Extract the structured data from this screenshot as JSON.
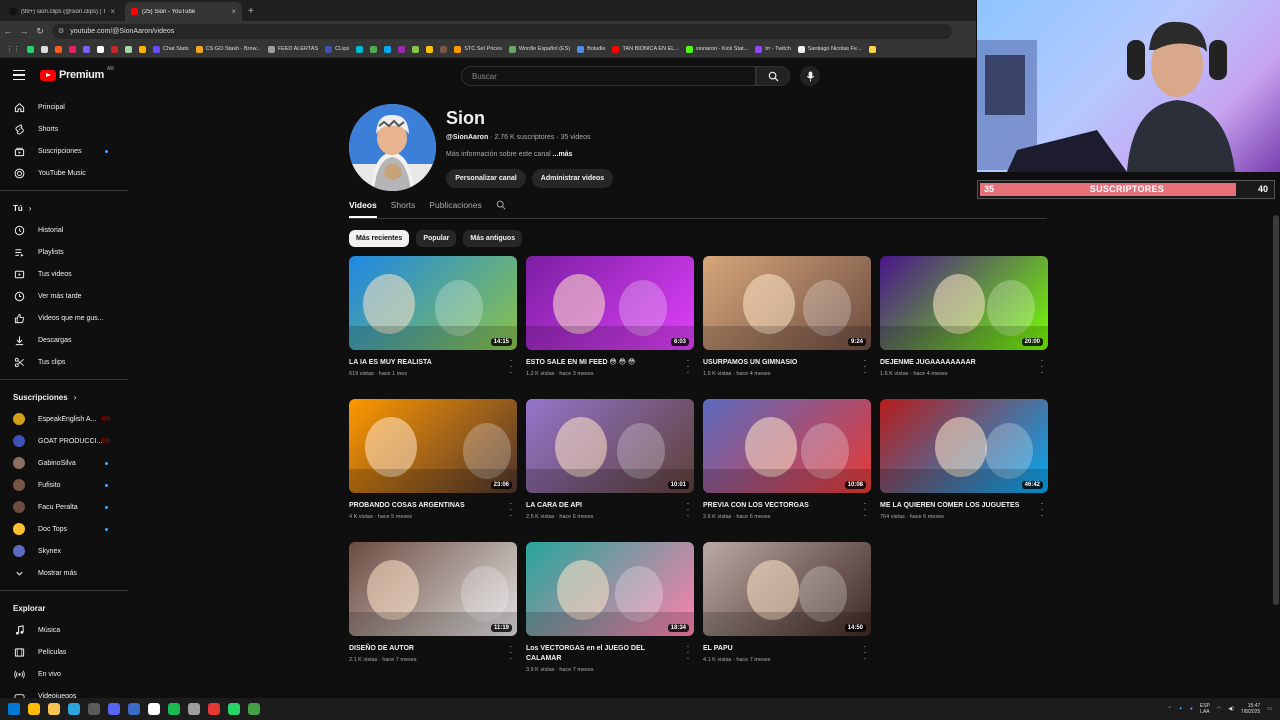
{
  "browser": {
    "tabs": [
      {
        "title": "(99+) sion.clips (@sion.clips) | TikTok",
        "active": false,
        "color": "#111111"
      },
      {
        "title": "(25) Sion - YouTube",
        "active": true,
        "color": "#ff0000"
      }
    ],
    "new_tab": "+",
    "url": "youtube.com/@SionAaron/videos",
    "bookmarks": [
      {
        "label": "",
        "color": "#25d366"
      },
      {
        "label": "",
        "color": "#dddddd"
      },
      {
        "label": "",
        "color": "#ff5a1f"
      },
      {
        "label": "",
        "color": "#e91e63"
      },
      {
        "label": "",
        "color": "#7b61ff"
      },
      {
        "label": "",
        "color": "#ffffff"
      },
      {
        "label": "",
        "color": "#c62828"
      },
      {
        "label": "",
        "color": "#a5d6a7"
      },
      {
        "label": "",
        "color": "#ffb300"
      },
      {
        "label": "Chat Stats",
        "color": "#6a4cff"
      },
      {
        "label": "CS:GO Stash - Brow...",
        "color": "#f5a623"
      },
      {
        "label": "FEED ALERTAS",
        "color": "#9e9e9e"
      },
      {
        "label": "CLips",
        "color": "#3f51b5"
      },
      {
        "label": "",
        "color": "#00bcd4"
      },
      {
        "label": "",
        "color": "#4caf50"
      },
      {
        "label": "",
        "color": "#03a9f4"
      },
      {
        "label": "",
        "color": "#9c27b0"
      },
      {
        "label": "",
        "color": "#8bc34a"
      },
      {
        "label": "",
        "color": "#ffc107"
      },
      {
        "label": "",
        "color": "#795548"
      },
      {
        "label": "STC Set Prices",
        "color": "#ff9800"
      },
      {
        "label": "Wordle Español (ES)",
        "color": "#6aaa64"
      },
      {
        "label": "Boludle",
        "color": "#4a90e2"
      },
      {
        "label": "TAN BIONICA EN EL...",
        "color": "#ff0000"
      },
      {
        "label": "sionaron - Kick Stat...",
        "color": "#53fc18"
      },
      {
        "label": "trr - Twitch",
        "color": "#9146ff"
      },
      {
        "label": "Santiago Nicolas Fe...",
        "color": "#eeeeee"
      },
      {
        "label": "",
        "color": "#ffd54f"
      }
    ]
  },
  "header": {
    "logo_text": "Premium",
    "logo_country": "AR",
    "search_placeholder": "Buscar"
  },
  "sidebar": {
    "main": [
      {
        "label": "Principal",
        "icon": "home-icon"
      },
      {
        "label": "Shorts",
        "icon": "shorts-icon"
      },
      {
        "label": "Suscripciones",
        "icon": "subscriptions-icon",
        "dot": true
      },
      {
        "label": "YouTube Music",
        "icon": "music-circle-icon"
      }
    ],
    "you_heading": "Tú",
    "you": [
      {
        "label": "Historial",
        "icon": "history-icon"
      },
      {
        "label": "Playlists",
        "icon": "playlists-icon"
      },
      {
        "label": "Tus videos",
        "icon": "your-videos-icon"
      },
      {
        "label": "Ver más tarde",
        "icon": "watch-later-icon"
      },
      {
        "label": "Videos que me gus...",
        "icon": "like-icon"
      },
      {
        "label": "Descargas",
        "icon": "download-icon"
      },
      {
        "label": "Tus clips",
        "icon": "clips-icon"
      }
    ],
    "subs_heading": "Suscripciones",
    "subs": [
      {
        "label": "EspeakEnglish A...",
        "color": "#d4a017",
        "live": true
      },
      {
        "label": "GOAT PRODUCCI...",
        "color": "#3f51b5",
        "live": true
      },
      {
        "label": "GabinoSilva",
        "color": "#8d6e63",
        "dot": true
      },
      {
        "label": "Fufisito",
        "color": "#795548",
        "dot": true
      },
      {
        "label": "Facu Peralta",
        "color": "#6d4c41",
        "dot": true
      },
      {
        "label": "Doc Tops",
        "color": "#fbc02d",
        "dot": true
      },
      {
        "label": "Skynex",
        "color": "#5c6bc0",
        "dot": false
      }
    ],
    "show_more": "Mostrar más",
    "explore_heading": "Explorar",
    "explore": [
      {
        "label": "Música",
        "icon": "music-note-icon"
      },
      {
        "label": "Películas",
        "icon": "movies-icon"
      },
      {
        "label": "En vivo",
        "icon": "live-icon"
      },
      {
        "label": "Videojuegos",
        "icon": "gaming-icon"
      }
    ]
  },
  "channel": {
    "name": "Sion",
    "handle": "@SionAaron",
    "meta": " · 2.76 K suscriptores · 35 videos",
    "more_text": "Más información sobre este canal ",
    "more_link": "...más",
    "customize_btn": "Personalizar canal",
    "manage_btn": "Administrar videos",
    "tabs": [
      "Videos",
      "Shorts",
      "Publicaciones"
    ],
    "chips": [
      "Más recientes",
      "Popular",
      "Más antiguos"
    ]
  },
  "videos": [
    {
      "title": "LA IA ES MUY REALISTA",
      "meta": "619 vistas · hace 1 mes",
      "duration": "14:15",
      "c1": "#1e88e5",
      "c2": "#8bc34a"
    },
    {
      "title": "ESTO SALE EN MI FEED 😳 😳 😳",
      "meta": "1.2 K vistas · hace 3 meses",
      "duration": "6:03",
      "c1": "#7b1fa2",
      "c2": "#e040fb"
    },
    {
      "title": "USURPAMOS UN GIMNASIO",
      "meta": "1.5 K vistas · hace 4 meses",
      "duration": "9:24",
      "c1": "#d7a77a",
      "c2": "#6d4c41"
    },
    {
      "title": "DEJENME JUGAAAAAAAAR",
      "meta": "1.6 K vistas · hace 4 meses",
      "duration": "20:00",
      "c1": "#4a148c",
      "c2": "#76ff03"
    },
    {
      "title": "PROBANDO COSAS ARGENTINAS",
      "meta": "4 K vistas · hace 5 meses",
      "duration": "23:06",
      "c1": "#ff9800",
      "c2": "#4e342e"
    },
    {
      "title": "LA CARA DE API",
      "meta": "2.5 K vistas · hace 6 meses",
      "duration": "10:01",
      "c1": "#9575cd",
      "c2": "#5d4037"
    },
    {
      "title": "PREVIA CON LOS VECTORGAS",
      "meta": "2.6 K vistas · hace 6 meses",
      "duration": "10:08",
      "c1": "#5c6bc0",
      "c2": "#e53935"
    },
    {
      "title": "ME LA QUIEREN COMER LOS JUGUETES",
      "meta": "764 vistas · hace 6 meses",
      "duration": "46:42",
      "c1": "#b71c1c",
      "c2": "#03a9f4"
    },
    {
      "title": "DISEÑO DE AUTOR",
      "meta": "2.1 K vistas · hace 7 meses",
      "duration": "11:19",
      "c1": "#6d4c41",
      "c2": "#e0e0e0"
    },
    {
      "title": "Los VECTORGAS en el JUEGO DEL CALAMAR",
      "meta": "3.9 K vistas · hace 7 meses",
      "duration": "18:34",
      "c1": "#26a69a",
      "c2": "#ff80ab"
    },
    {
      "title": "EL PAPU",
      "meta": "4.1 K vistas · hace 7 meses",
      "duration": "14:50",
      "c1": "#bcaaa4",
      "c2": "#3e2723"
    }
  ],
  "overlay": {
    "current": "35",
    "label": "SUSCRIPTORES",
    "goal": "40",
    "bar_color": "#e6717a"
  },
  "taskbar": {
    "icons": [
      {
        "name": "windows-start-icon",
        "color": "#0078d4"
      },
      {
        "name": "chrome-icon",
        "color": "#fbbc05"
      },
      {
        "name": "file-explorer-icon",
        "color": "#f8c44f"
      },
      {
        "name": "telegram-icon",
        "color": "#2aa3df"
      },
      {
        "name": "obs-icon",
        "color": "#5c5c5c"
      },
      {
        "name": "discord-icon",
        "color": "#5865f2"
      },
      {
        "name": "app-icon",
        "color": "#3b6bc6"
      },
      {
        "name": "notepad-icon",
        "color": "#ffffff"
      },
      {
        "name": "spotify-icon",
        "color": "#1db954"
      },
      {
        "name": "app2-icon",
        "color": "#9e9e9e"
      },
      {
        "name": "app3-icon",
        "color": "#e53935"
      },
      {
        "name": "whatsapp-icon",
        "color": "#25d366"
      },
      {
        "name": "app4-icon",
        "color": "#43a047"
      }
    ],
    "lang1": "ESP",
    "lang2": "LAA",
    "time": "15:47",
    "date": "7/8/2025"
  }
}
